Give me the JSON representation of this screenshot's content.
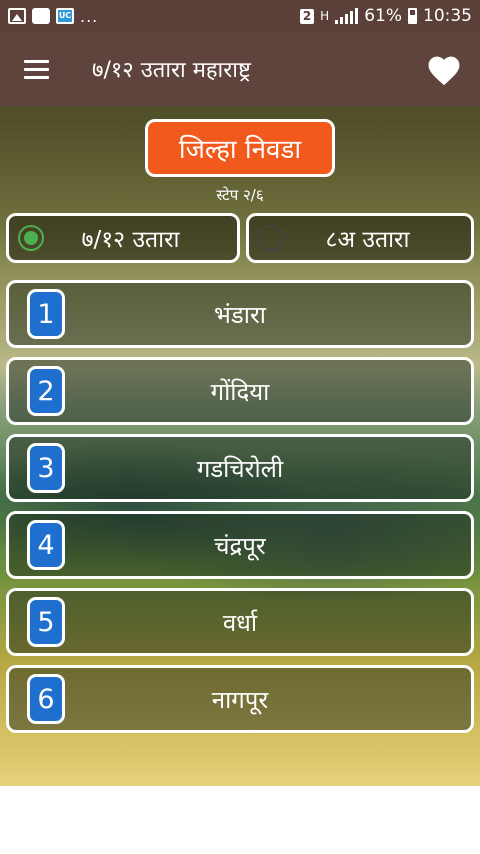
{
  "status_bar": {
    "notification_icons": [
      "image-icon",
      "message-icon",
      "uc-browser-icon"
    ],
    "uc_label": "UC",
    "more": "...",
    "sim_badge": "2",
    "network": "H",
    "battery": "61%",
    "time": "10:35"
  },
  "app_bar": {
    "menu_icon": "hamburger-menu-icon",
    "title": "७/१२ उतारा महाराष्ट्र",
    "favorite_icon": "heart-icon"
  },
  "header": {
    "button_label": "जिल्हा निवडा",
    "step": "स्टेप २/६",
    "accent_color": "#f25a1d"
  },
  "options": [
    {
      "label": "७/१२ उतारा",
      "selected": true
    },
    {
      "label": "८अ उतारा",
      "selected": false
    }
  ],
  "districts": [
    {
      "number": "1",
      "name": "भंडारा"
    },
    {
      "number": "2",
      "name": "गोंदिया"
    },
    {
      "number": "3",
      "name": "गडचिरोली"
    },
    {
      "number": "4",
      "name": "चंद्रपूर"
    },
    {
      "number": "5",
      "name": "वर्धा"
    },
    {
      "number": "6",
      "name": "नागपूर"
    }
  ],
  "colors": {
    "app_bar": "#5e443c",
    "badge": "#1f6fcf",
    "radio_checked": "#4caf50"
  }
}
